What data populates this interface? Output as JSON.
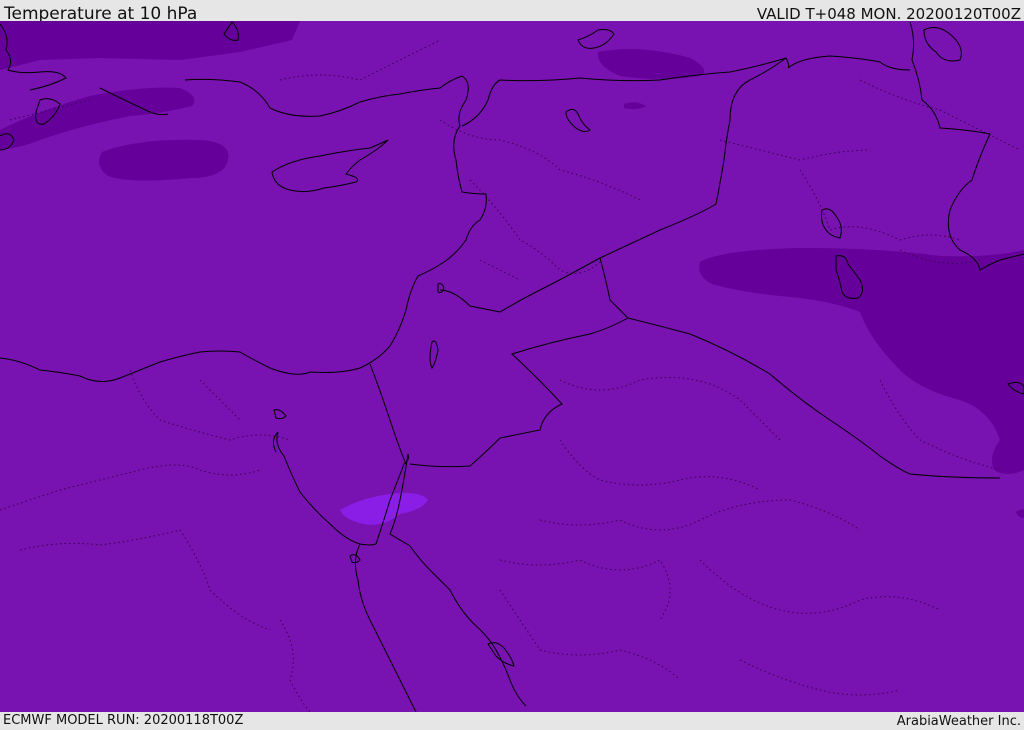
{
  "header": {
    "title": "Temperature at 10 hPa",
    "valid": "VALID T+048 MON. 20200120T00Z"
  },
  "footer": {
    "model_run": "ECMWF MODEL RUN: 20200118T00Z",
    "credit": "ArabiaWeather Inc."
  },
  "colors": {
    "field_base": "#7812b0",
    "field_cold": "#66009a",
    "field_warm": "#8a1ee6",
    "coastline": "#000000",
    "border_dotted": "#3a0050"
  }
}
